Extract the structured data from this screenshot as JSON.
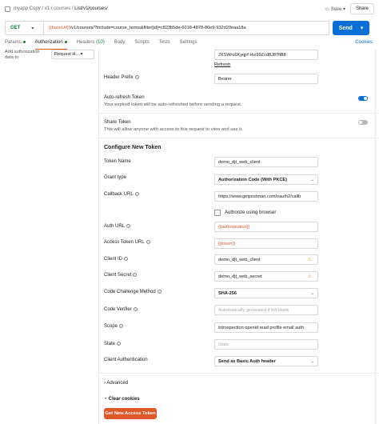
{
  "breadcrumb": {
    "workspace": "myapp Copy",
    "sep": "/",
    "part1": "v1",
    "part2": "courses",
    "current": "List/v1/courses/"
  },
  "header": {
    "save_label": "Save",
    "share_label": "Share"
  },
  "request": {
    "method": "GET",
    "url_var": "{{baseUrl}}",
    "url_rest": "/v1/courses/?include=course_terms&filter[id]=c823b5de-6018-4878-80e9-932d20eaa18a",
    "send_label": "Send"
  },
  "tabs": [
    {
      "label": "Params",
      "dot": true
    },
    {
      "label": "Authorization",
      "dot": true,
      "active": true
    },
    {
      "label": "Headers",
      "count": "(10)"
    },
    {
      "label": "Body"
    },
    {
      "label": "Scripts"
    },
    {
      "label": "Tests"
    },
    {
      "label": "Settings"
    }
  ],
  "cookies_label": "Cookies",
  "left": {
    "add_auth_label": "Add authorization data to",
    "add_auth_value": "Request H..."
  },
  "token_top": {
    "token_value": "JXSWru6Kyqjrf Hvi99Zcd8J87fiB8",
    "refresh": "Refresh"
  },
  "header_prefix": {
    "label": "Header Prefix",
    "value": "Bearer"
  },
  "auto_refresh": {
    "label": "Auto-refresh Token",
    "desc": "Your expired token will be auto-refreshed before sending a request.",
    "on": true
  },
  "share_token": {
    "label": "Share Token",
    "desc": "This will allow anyone with access to this request to view and use it.",
    "on": false
  },
  "configure_title": "Configure New Token",
  "fields": {
    "token_name": {
      "label": "Token Name",
      "value": "demo_djt_web_client"
    },
    "grant_type": {
      "label": "Grant type",
      "value": "Authorization Code (With PKCE)"
    },
    "callback_url": {
      "label": "Callback URL",
      "value": "https://www.getpostman.com/oauth2/callb"
    },
    "authorize_browser": "Authorize using browser",
    "auth_url": {
      "label": "Auth URL",
      "value": "{{authorization}}"
    },
    "access_token_url": {
      "label": "Access Token URL",
      "value": "{{token}}"
    },
    "client_id": {
      "label": "Client ID",
      "value": "demo_djt_web_client"
    },
    "client_secret": {
      "label": "Client Secret",
      "value": "demo_djt_web_secret"
    },
    "code_challenge": {
      "label": "Code Challenge Method",
      "value": "SHA-256"
    },
    "code_verifier": {
      "label": "Code Verifier",
      "placeholder": "Automatically generated if left blank"
    },
    "scope": {
      "label": "Scope",
      "value": "introspection openid read profile email auth"
    },
    "state": {
      "label": "State",
      "placeholder": "State"
    },
    "client_auth": {
      "label": "Client Authentication",
      "value": "Send as Basic Auth header"
    }
  },
  "advanced_label": "Advanced",
  "clear_cookies_label": "Clear cookies",
  "get_token_label": "Get New Access Token",
  "colors": {
    "accent": "#e0582a",
    "send": "#0a6fd6",
    "toggle_on": "#0a6fd6",
    "toggle_off": "#b9b9b9",
    "method": "#0c7a2f"
  }
}
